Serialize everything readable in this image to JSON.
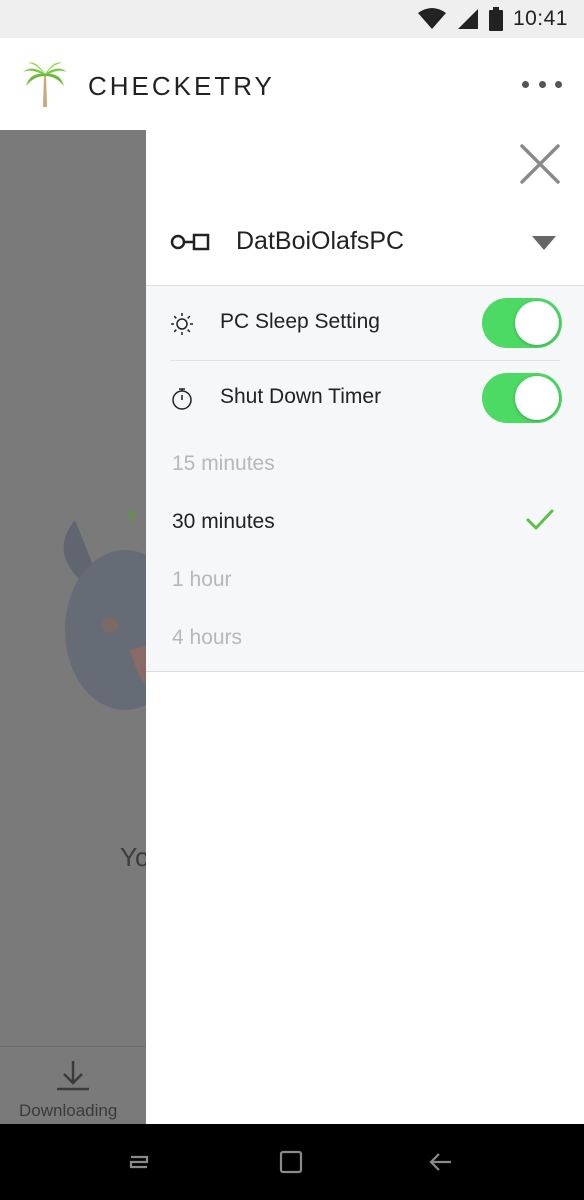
{
  "status_bar": {
    "time": "10:41",
    "icons": [
      "wifi-icon",
      "cell-signal-icon",
      "battery-icon"
    ]
  },
  "app_bar": {
    "title": "CHECKETRY",
    "logo_icon": "palm-tree-icon",
    "menu_icon": "more-horizontal-icon"
  },
  "background": {
    "partial_text": "Yo",
    "download_label": "Downloading"
  },
  "drawer": {
    "close_icon": "close-icon",
    "device": {
      "name": "DatBoiOlafsPC",
      "icon": "link-device-icon"
    },
    "settings": [
      {
        "label": "PC Sleep Setting",
        "icon": "sun-icon",
        "enabled": true
      },
      {
        "label": "Shut Down Timer",
        "icon": "timer-icon",
        "enabled": true
      }
    ],
    "timer_options": [
      {
        "label": "15 minutes",
        "selected": false
      },
      {
        "label": "30 minutes",
        "selected": true
      },
      {
        "label": "1 hour",
        "selected": false
      },
      {
        "label": "4 hours",
        "selected": false
      }
    ]
  },
  "colors": {
    "accent_green": "#4cd964",
    "check_green": "#5cc04a",
    "logo_green": "#7ac943"
  }
}
